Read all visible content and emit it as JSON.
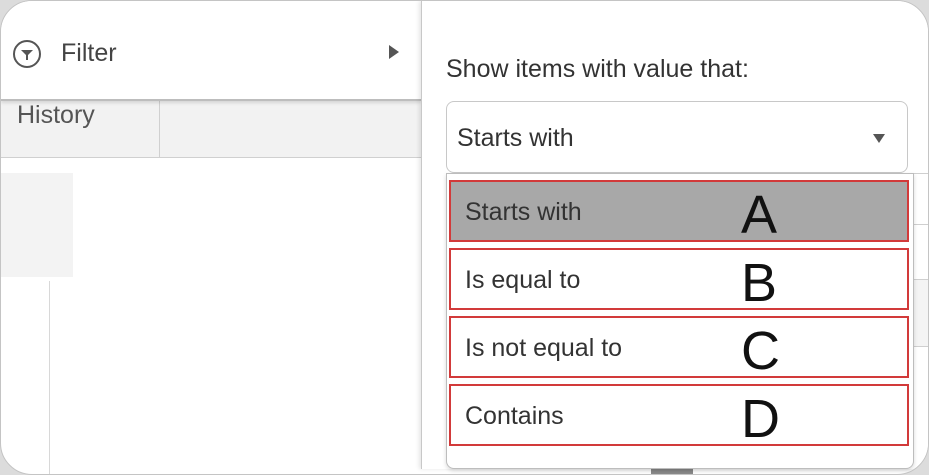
{
  "menu": {
    "filter_label": "Filter",
    "history_label": "History"
  },
  "filter_panel": {
    "show_items_label": "Show items with value that:",
    "selected_value": "Starts with",
    "options": [
      {
        "label": "Starts with",
        "letter": "A",
        "selected": true
      },
      {
        "label": "Is equal to",
        "letter": "B",
        "selected": false
      },
      {
        "label": "Is not equal to",
        "letter": "C",
        "selected": false
      },
      {
        "label": "Contains",
        "letter": "D",
        "selected": false
      }
    ]
  },
  "icons": {
    "filter": "filter-icon",
    "submenu": "chevron-right-icon",
    "dropdown": "chevron-down-icon"
  },
  "colors": {
    "highlight_border": "#d23a3a",
    "selected_background": "#a8a8a8"
  }
}
